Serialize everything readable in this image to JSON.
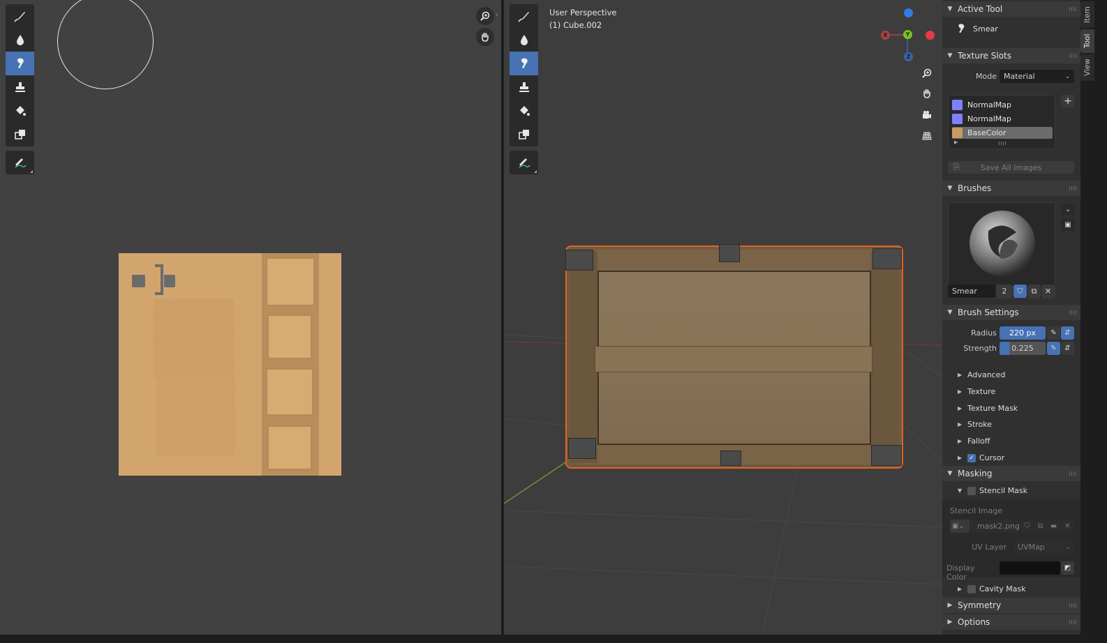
{
  "image_editor": {
    "tools": [
      "draw-icon",
      "soften-icon",
      "smear-icon",
      "clone-icon",
      "fill-icon",
      "mask-icon",
      "annotate-icon"
    ]
  },
  "viewport": {
    "title_line1": "User Perspective",
    "title_line2": "(1) Cube.002",
    "gizmo": {
      "x": "X",
      "y": "Y",
      "z": "Z"
    }
  },
  "panel": {
    "tabs": [
      "Item",
      "Tool",
      "View"
    ],
    "active_tool": {
      "header": "Active Tool",
      "name": "Smear"
    },
    "texture_slots": {
      "header": "Texture Slots",
      "mode_label": "Mode",
      "mode_value": "Material",
      "slots": [
        {
          "name": "NormalMap",
          "color": "#8080ff"
        },
        {
          "name": "NormalMap",
          "color": "#8080ff"
        },
        {
          "name": "BaseColor",
          "color": "#c89a62"
        }
      ],
      "save_all": "Save All Images"
    },
    "brushes": {
      "header": "Brushes",
      "brush_name": "Smear",
      "users": "2"
    },
    "brush_settings": {
      "header": "Brush Settings",
      "radius_label": "Radius",
      "radius_value": "220 px",
      "strength_label": "Strength",
      "strength_value": "0.225",
      "subpanels": [
        "Advanced",
        "Texture",
        "Texture Mask",
        "Stroke",
        "Falloff"
      ],
      "cursor_label": "Cursor"
    },
    "masking": {
      "header": "Masking",
      "stencil_mask": "Stencil Mask",
      "stencil_image_label": "Stencil Image",
      "stencil_image": "mask2.png",
      "uv_layer_label": "UV Layer",
      "uv_layer_value": "UVMap",
      "display_color_label": "Display Color",
      "cavity_mask": "Cavity Mask"
    },
    "symmetry": "Symmetry",
    "options": "Options"
  },
  "colors": {
    "accent": "#4772b3",
    "selection_outline": "#e2641c",
    "texture_base": "#d3a56e"
  }
}
